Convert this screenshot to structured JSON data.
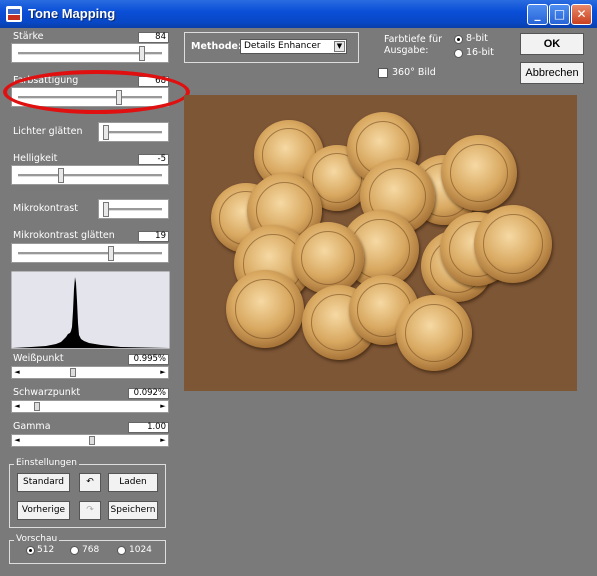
{
  "window": {
    "title": "Tone Mapping"
  },
  "controls": {
    "staerke": {
      "label": "Stärke",
      "value": "84"
    },
    "farbsaettigung": {
      "label": "Farbsättigung",
      "value": "68"
    },
    "lichter": {
      "label": "Lichter glätten"
    },
    "helligkeit": {
      "label": "Helligkeit",
      "value": "-5"
    },
    "mikrokontrast": {
      "label": "Mikrokontrast"
    },
    "mikro_glaetten": {
      "label": "Mikrokontrast glätten",
      "value": "19"
    },
    "weisspunkt": {
      "label": "Weißpunkt",
      "value": "0.995%"
    },
    "schwarzpunkt": {
      "label": "Schwarzpunkt",
      "value": "0.092%"
    },
    "gamma": {
      "label": "Gamma",
      "value": "1.00"
    }
  },
  "einstellungen": {
    "title": "Einstellungen",
    "standard": "Standard",
    "laden": "Laden",
    "vorherige": "Vorherige",
    "speichern": "Speichern"
  },
  "vorschau": {
    "title": "Vorschau",
    "options": [
      "512",
      "768",
      "1024"
    ],
    "selected": "512"
  },
  "methode": {
    "label": "Methode:",
    "value": "Details Enhancer"
  },
  "output": {
    "label": "Farbtiefe für Ausgabe:",
    "options": [
      "8-bit",
      "16-bit"
    ],
    "selected": "8-bit",
    "bild360": "360° Bild"
  },
  "buttons": {
    "ok": "OK",
    "cancel": "Abbrechen"
  },
  "colors": {
    "annotation": "#e01010",
    "titlebar": "#0a4fd8",
    "panel": "#7a7a7a"
  }
}
